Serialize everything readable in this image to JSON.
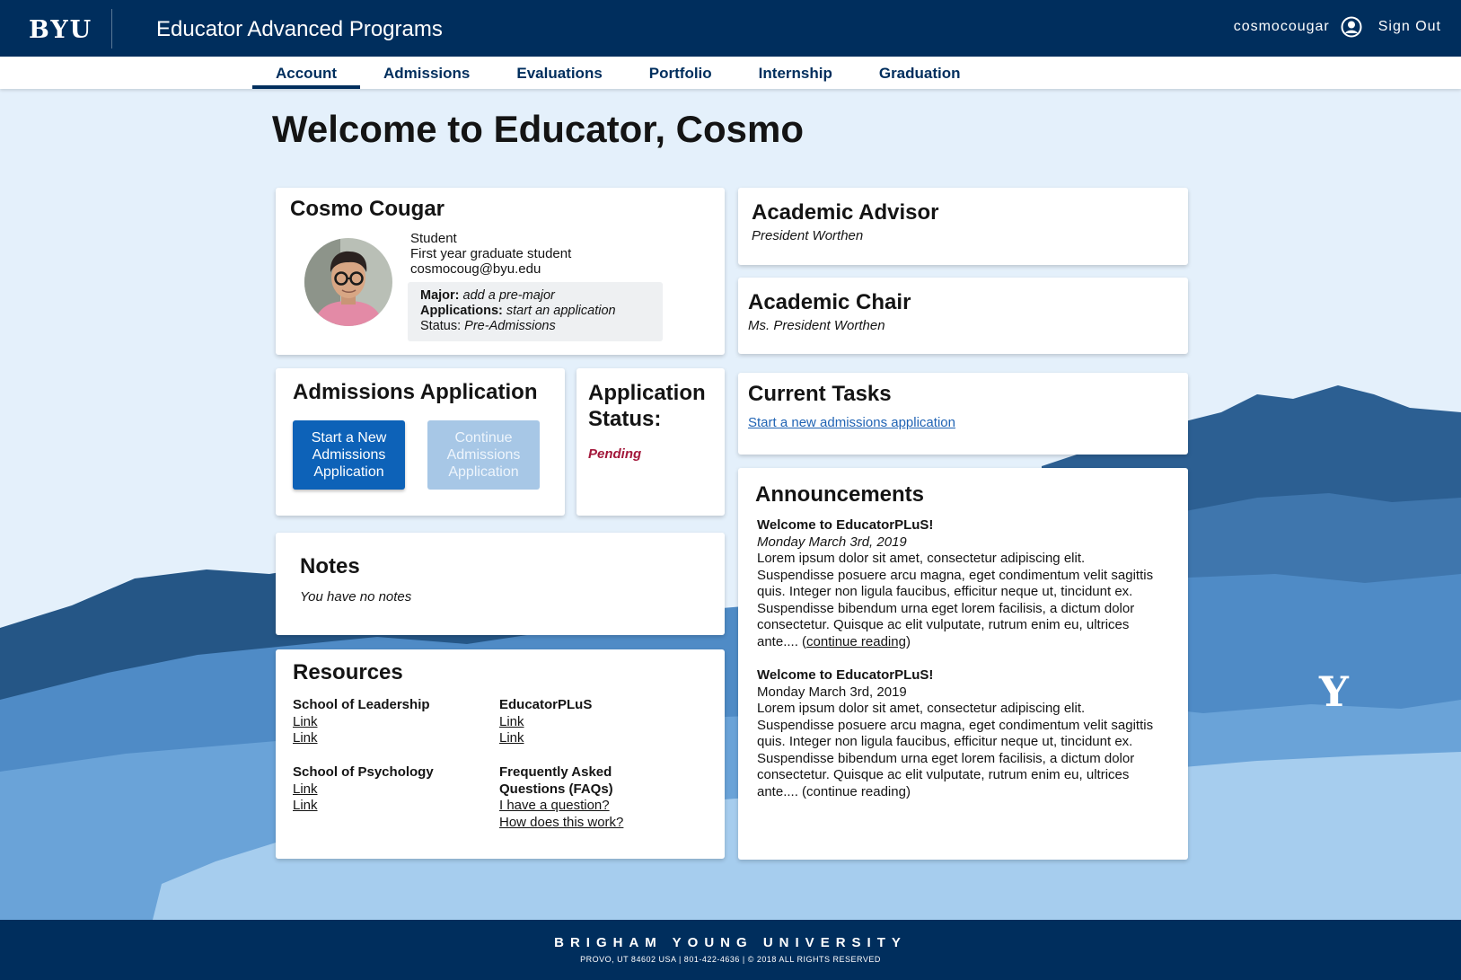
{
  "header": {
    "logo": "BYU",
    "app_title": "Educator Advanced Programs",
    "username": "cosmocougar",
    "signout_label": "Sign Out"
  },
  "tabs": [
    {
      "label": "Account",
      "active": true
    },
    {
      "label": "Admissions"
    },
    {
      "label": "Evaluations"
    },
    {
      "label": "Portfolio"
    },
    {
      "label": "Internship"
    },
    {
      "label": "Graduation"
    }
  ],
  "page_title": "Welcome to Educator, Cosmo",
  "profile": {
    "name": "Cosmo Cougar",
    "role": "Student",
    "year": "First year graduate student",
    "email": "cosmocoug@byu.edu",
    "major_label": "Major:",
    "major_value": "add a pre-major",
    "applications_label": "Applications:",
    "applications_value": "start an application",
    "status_label": "Status:",
    "status_value": "Pre-Admissions"
  },
  "advisor": {
    "title": "Academic Advisor",
    "name": "President Worthen"
  },
  "chair": {
    "title": "Academic Chair",
    "name": "Ms. President Worthen"
  },
  "admissions": {
    "title": "Admissions Application",
    "start_button": "Start a New Admissions Application",
    "continue_button": "Continue Admissions Application"
  },
  "app_status": {
    "title": "Application Status:",
    "value": "Pending"
  },
  "tasks": {
    "title": "Current Tasks",
    "link": "Start a new admissions application"
  },
  "notes": {
    "title": "Notes",
    "empty": "You have no notes"
  },
  "announcements": {
    "title": "Announcements",
    "items": [
      {
        "title": "Welcome to EducatorPLuS!",
        "date": "Monday March 3rd, 2019",
        "body": "Lorem ipsum dolor sit amet, consectetur adipiscing elit. Suspendisse posuere arcu magna, eget condimentum velit sagittis quis. Integer non ligula faucibus, efficitur neque ut, tincidunt ex. Suspendisse bibendum urna eget lorem facilisis, a dictum dolor consectetur. Quisque ac elit vulputate, rutrum enim eu, ultrices ante.... (",
        "link": "continue reading",
        "after": ")"
      },
      {
        "title": "Welcome to EducatorPLuS!",
        "date": "Monday March 3rd, 2019",
        "body": "Lorem ipsum dolor sit amet, consectetur adipiscing elit. Suspendisse posuere arcu magna, eget condimentum velit sagittis quis. Integer non ligula faucibus, efficitur neque ut, tincidunt ex. Suspendisse bibendum urna eget lorem facilisis, a dictum dolor consectetur. Quisque ac elit vulputate, rutrum enim eu, ultrices ante.... (continue reading)"
      }
    ]
  },
  "resources": {
    "title": "Resources",
    "groups": [
      {
        "heading": "School of Leadership",
        "links": [
          "Link",
          "Link"
        ]
      },
      {
        "heading": "EducatorPLuS",
        "links": [
          "Link",
          "Link"
        ]
      },
      {
        "heading": "School of Psychology",
        "links": [
          "Link",
          "Link"
        ]
      },
      {
        "heading": "Frequently Asked Questions (FAQs)",
        "links": [
          "I have a question?",
          "How does this work?"
        ]
      }
    ]
  },
  "footer": {
    "university": "BRIGHAM YOUNG UNIVERSITY",
    "address": "PROVO, UT 84602 USA  |  801-422-4636  |  © 2018 ALL RIGHTS RESERVED"
  },
  "decor": {
    "y_mark": "Y"
  },
  "colors": {
    "navy": "#002e5d",
    "primary_button": "#0d62b8",
    "pending": "#a3183b",
    "link": "#1f63b4"
  }
}
